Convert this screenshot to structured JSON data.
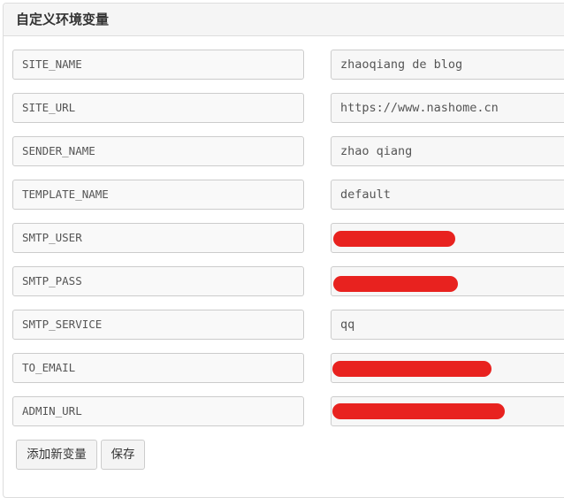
{
  "panel": {
    "title": "自定义环境变量"
  },
  "variables": [
    {
      "name": "SITE_NAME",
      "value": "zhaoqiang de blog",
      "redacted": false
    },
    {
      "name": "SITE_URL",
      "value": "https://www.nashome.cn",
      "redacted": false
    },
    {
      "name": "SENDER_NAME",
      "value": "zhao qiang",
      "redacted": false
    },
    {
      "name": "TEMPLATE_NAME",
      "value": "default",
      "redacted": false
    },
    {
      "name": "SMTP_USER",
      "value": "",
      "redacted": true
    },
    {
      "name": "SMTP_PASS",
      "value": "",
      "redacted": true
    },
    {
      "name": "SMTP_SERVICE",
      "value": "qq",
      "redacted": false
    },
    {
      "name": "TO_EMAIL",
      "value": "",
      "redacted": true
    },
    {
      "name": "ADMIN_URL",
      "value": "",
      "redacted": true
    }
  ],
  "buttons": {
    "add_label": "添加新变量",
    "save_label": "保存"
  },
  "colors": {
    "redaction": "#e8221f",
    "field_background": "#f9f9f9",
    "border": "#cccccc",
    "heading_background": "#f5f5f5"
  }
}
